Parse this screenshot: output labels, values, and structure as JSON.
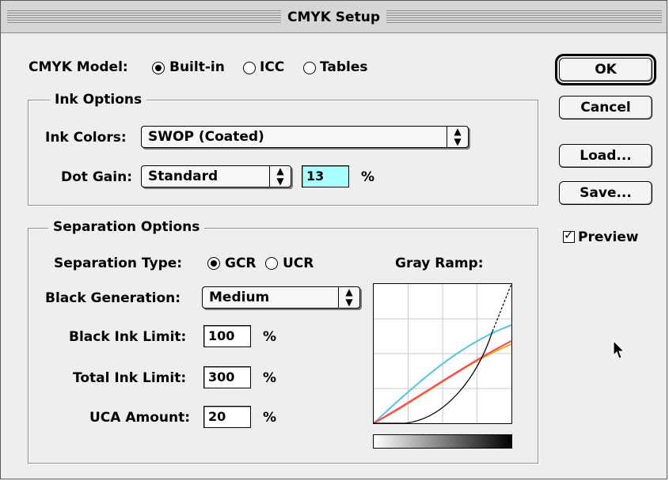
{
  "window": {
    "title": "CMYK Setup"
  },
  "cmyk_model": {
    "label": "CMYK Model:",
    "options": [
      "Built-in",
      "ICC",
      "Tables"
    ],
    "selected": "Built-in"
  },
  "ink_options": {
    "group_label": "Ink Options",
    "ink_colors_label": "Ink Colors:",
    "ink_colors_value": "SWOP (Coated)",
    "dot_gain_label": "Dot Gain:",
    "dot_gain_value": "Standard",
    "dot_gain_percent": "13",
    "percent_symbol": "%"
  },
  "separation_options": {
    "group_label": "Separation Options",
    "type_label": "Separation Type:",
    "type_options": [
      "GCR",
      "UCR"
    ],
    "type_selected": "GCR",
    "black_generation_label": "Black Generation:",
    "black_generation_value": "Medium",
    "black_ink_limit_label": "Black Ink Limit:",
    "black_ink_limit_value": "100",
    "total_ink_limit_label": "Total Ink Limit:",
    "total_ink_limit_value": "300",
    "uca_amount_label": "UCA Amount:",
    "uca_amount_value": "20",
    "percent_symbol": "%",
    "gray_ramp_label": "Gray Ramp:"
  },
  "buttons": {
    "ok": "OK",
    "cancel": "Cancel",
    "load": "Load...",
    "save": "Save..."
  },
  "preview": {
    "label": "Preview",
    "checked": true
  },
  "colors": {
    "cyan": "#4fc3e8",
    "magenta": "#ff3b6b",
    "yellow": "#f5b400",
    "black": "#000000",
    "field_highlight": "#a8ffff"
  },
  "icons": {
    "cursor": "arrow-cursor-icon"
  }
}
